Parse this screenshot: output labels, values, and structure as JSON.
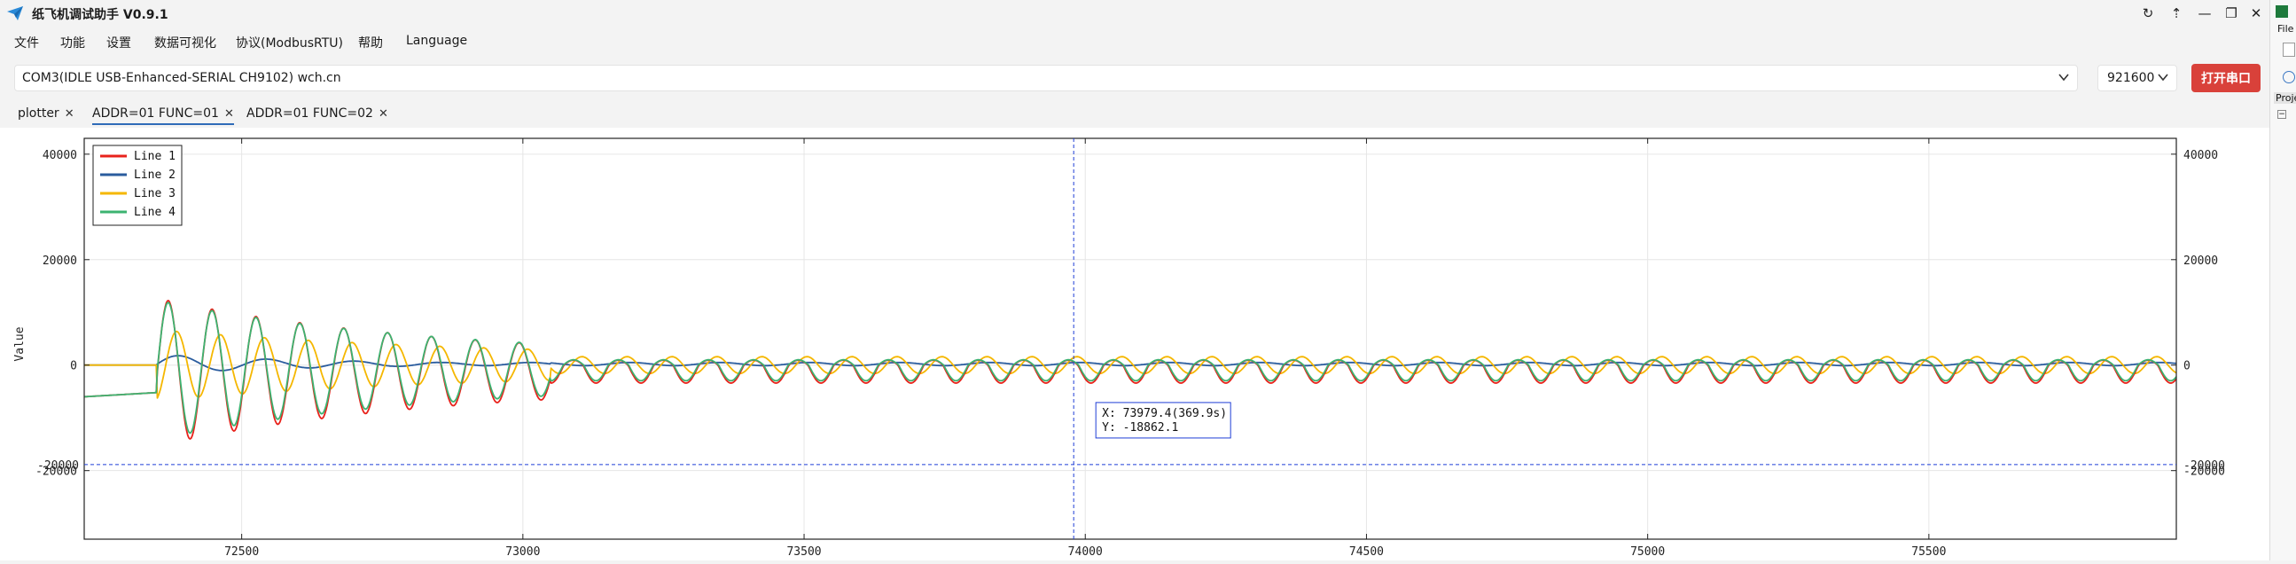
{
  "window": {
    "title": "纸飞机调试助手 V0.9.1",
    "controls": [
      "↻",
      "⇡",
      "—",
      "❐",
      "✕"
    ]
  },
  "menu": [
    "文件",
    "功能",
    "设置",
    "数据可视化",
    "协议(ModbusRTU)",
    "帮助",
    "Language"
  ],
  "toolbar": {
    "port_value": "COM3(IDLE  USB-Enhanced-SERIAL CH9102) wch.cn",
    "baud_value": "921600",
    "open_button": "打开串口"
  },
  "tabs": [
    {
      "label": "plotter",
      "active": false
    },
    {
      "label": "ADDR=01 FUNC=01",
      "active": true
    },
    {
      "label": "ADDR=01 FUNC=02",
      "active": false
    }
  ],
  "right_panel": {
    "file_label": "File",
    "project_label": "Proje"
  },
  "chart_data": {
    "type": "line",
    "ylabel": "Value",
    "xlabel": "",
    "xlim": [
      72220,
      75940
    ],
    "ylim": [
      -33000,
      43000
    ],
    "x_ticks": [
      72500,
      73000,
      73500,
      74000,
      74500,
      75000,
      75500
    ],
    "y_ticks": [
      -20000,
      0,
      20000,
      40000
    ],
    "y_tick_labels": [
      "-20000",
      "0",
      "20000",
      "40000"
    ],
    "grid": true,
    "legend_position": "top-left",
    "series": [
      {
        "name": "Line 1",
        "color": "#e8221b"
      },
      {
        "name": "Line 2",
        "color": "#2a5c9e"
      },
      {
        "name": "Line 3",
        "color": "#f5b700"
      },
      {
        "name": "Line 4",
        "color": "#3cb371"
      }
    ],
    "crosshair": {
      "x": 73979.4,
      "y": -18862.1
    },
    "tooltip": {
      "x_text": "X: 73979.4(369.9s)",
      "y_text": "Y: -18862.1"
    }
  }
}
